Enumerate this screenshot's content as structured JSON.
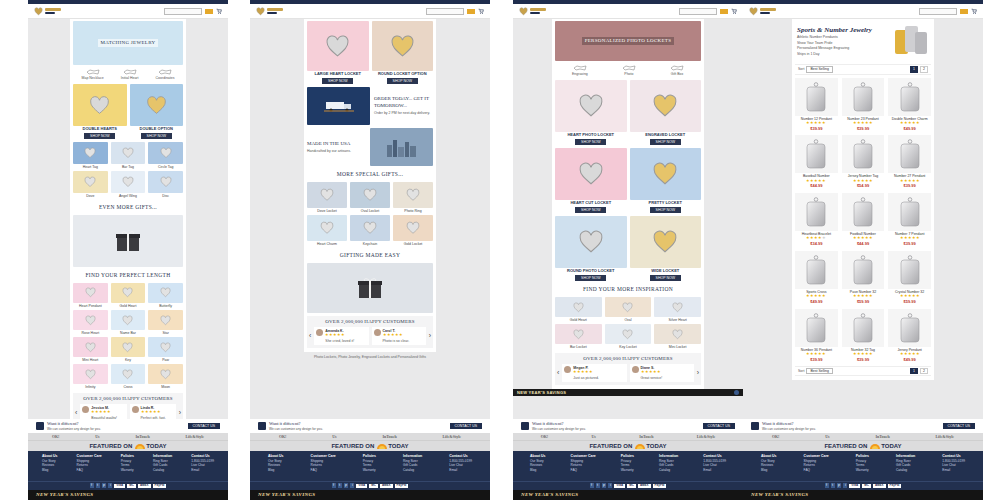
{
  "footer": {
    "custom": {
      "title": "Want it different?",
      "text": "We can customize any design for you.",
      "button": "CONTACT US"
    },
    "press": [
      "OK!",
      "Us",
      "InTouch",
      "Life&Style"
    ],
    "featured": "FEATURED ON",
    "featured_logo": "TODAY",
    "columns": [
      {
        "title": "About Us",
        "links": [
          "Our Story",
          "Reviews",
          "Blog"
        ]
      },
      {
        "title": "Customer Care",
        "links": [
          "Shipping",
          "Returns",
          "FAQ"
        ]
      },
      {
        "title": "Policies",
        "links": [
          "Privacy",
          "Terms",
          "Warranty"
        ]
      },
      {
        "title": "Information",
        "links": [
          "Ring Sizer",
          "Gift Cards",
          "Catalog"
        ]
      },
      {
        "title": "Contact Us",
        "links": [
          "1-800-555-0199",
          "Live Chat",
          "Email"
        ]
      }
    ],
    "social": [
      "f",
      "t",
      "p",
      "i"
    ],
    "payments": [
      "VISA",
      "MC",
      "AMEX",
      "PayPal"
    ],
    "promo": "NEW YEAR'S SAVINGS"
  },
  "panels": [
    {
      "sections": [
        {
          "kind": "hero",
          "title": "MATCHING JEWELRY"
        },
        {
          "kind": "icons",
          "labels": [
            "Map Necklace",
            "Initial Heart",
            "Coordinates"
          ]
        },
        {
          "kind": "pair",
          "items": [
            {
              "caption": "DOUBLE HEARTS",
              "button": "SHOP NOW"
            },
            {
              "caption": "DOUBLE OPTION",
              "button": "SHOP NOW"
            }
          ]
        },
        {
          "kind": "grid",
          "items": [
            {
              "caption": "Heart Tag"
            },
            {
              "caption": "Bar Tag"
            },
            {
              "caption": "Circle Tag"
            },
            {
              "caption": "Dove"
            },
            {
              "caption": "Angel Wing"
            },
            {
              "caption": "Disc"
            }
          ]
        },
        {
          "kind": "heading",
          "title": "EVEN MORE GIFTS..."
        },
        {
          "kind": "hero",
          "title": ""
        },
        {
          "kind": "heading",
          "title": "FIND YOUR PERFECT LENGTH"
        },
        {
          "kind": "grid",
          "items": [
            {
              "caption": "Heart Pendant"
            },
            {
              "caption": "Gold Heart"
            },
            {
              "caption": "Butterfly"
            },
            {
              "caption": "Rose Heart"
            },
            {
              "caption": "Name Bar"
            },
            {
              "caption": "Star"
            },
            {
              "caption": "Mini Heart"
            },
            {
              "caption": "Key"
            },
            {
              "caption": "Paw"
            },
            {
              "caption": "Infinity"
            },
            {
              "caption": "Cross"
            },
            {
              "caption": "Moon"
            }
          ]
        },
        {
          "kind": "reviews",
          "title": "OVER 2,000,000 HAPPY CUSTOMERS",
          "prev": "‹",
          "next": "›",
          "reviews": [
            {
              "name": "Jessica M.",
              "text": "Beautiful quality!",
              "stars": 5
            },
            {
              "name": "Linda R.",
              "text": "Perfect gift, fast.",
              "stars": 5
            }
          ]
        }
      ],
      "note": ""
    },
    {
      "sections": [
        {
          "kind": "pair",
          "items": [
            {
              "caption": "LARGE HEART LOCKET",
              "button": "SHOP NOW"
            },
            {
              "caption": "ROUND LOCKET OPTION",
              "button": "SHOP NOW"
            }
          ]
        },
        {
          "kind": "feature",
          "title": "ORDER TODAY... GET IT TOMORROW...",
          "text": "Order by 2 PM for next-day delivery."
        },
        {
          "kind": "featurerev",
          "title": "MADE IN THE USA",
          "text": "Handcrafted by our artisans."
        },
        {
          "kind": "heading",
          "title": "MORE SPECIAL GIFTS..."
        },
        {
          "kind": "grid",
          "items": [
            {
              "caption": "Dove Locket"
            },
            {
              "caption": "Oval Locket"
            },
            {
              "caption": "Photo Ring"
            },
            {
              "caption": "Heart Charm"
            },
            {
              "caption": "Keychain"
            },
            {
              "caption": "Gold Locket"
            }
          ]
        },
        {
          "kind": "heading",
          "title": "GIFTING MADE EASY"
        },
        {
          "kind": "hero",
          "title": ""
        },
        {
          "kind": "reviews",
          "title": "OVER 2,000,000 HAPPY CUSTOMERS",
          "prev": "‹",
          "next": "›",
          "reviews": [
            {
              "name": "Amanda K.",
              "text": "She cried, loved it!",
              "stars": 5
            },
            {
              "name": "Carol T.",
              "text": "Photo is so clear.",
              "stars": 5
            }
          ]
        }
      ],
      "note": "Photo Lockets, Photo Jewelry, Engraved Lockets and Personalized Gifts"
    },
    {
      "sections": [
        {
          "kind": "hero",
          "title": "PERSONALIZED PHOTO LOCKETS"
        },
        {
          "kind": "icons",
          "labels": [
            "Engraving",
            "Photo",
            "Gift Box"
          ]
        },
        {
          "kind": "pair",
          "items": [
            {
              "caption": "HEART PHOTO LOCKET",
              "button": "SHOP NOW"
            },
            {
              "caption": "ENGRAVED LOCKET",
              "button": "SHOP NOW"
            }
          ]
        },
        {
          "kind": "pair",
          "items": [
            {
              "caption": "HEART CUT LOCKET",
              "button": "SHOP NOW"
            },
            {
              "caption": "PRETTY LOCKET",
              "button": "SHOP NOW"
            }
          ]
        },
        {
          "kind": "pair",
          "items": [
            {
              "caption": "ROUND PHOTO LOCKET",
              "button": "SHOP NOW"
            },
            {
              "caption": "WIDE LOCKET",
              "button": "SHOP NOW"
            }
          ]
        },
        {
          "kind": "heading",
          "title": "FIND YOUR MORE INSPIRATION"
        },
        {
          "kind": "grid",
          "items": [
            {
              "caption": "Gold Heart"
            },
            {
              "caption": "Oval"
            },
            {
              "caption": "Silver Heart"
            },
            {
              "caption": "Bar Locket"
            },
            {
              "caption": "Key Locket"
            },
            {
              "caption": "Mini Locket"
            }
          ]
        },
        {
          "kind": "reviews",
          "title": "OVER 2,000,000 HAPPY CUSTOMERS",
          "prev": "‹",
          "next": "›",
          "reviews": [
            {
              "name": "Megan P.",
              "text": "Just as pictured.",
              "stars": 5
            },
            {
              "name": "Diane S.",
              "text": "Great service!",
              "stars": 5
            }
          ]
        }
      ],
      "note": "",
      "banner": "NEW YEAR'S SAVINGS"
    },
    {
      "sections": [
        {
          "kind": "intro",
          "title": "Sports & Number Jewelry",
          "lines": [
            "Athletic Number Pendants",
            "Show Your Team Pride",
            "Personalized Message Engraving",
            "Ships in 1 Day"
          ]
        },
        {
          "kind": "toolbar",
          "label": "Sort",
          "value": "Best Selling",
          "pages": [
            {
              "label": "1",
              "selected": true
            },
            {
              "label": "2",
              "selected": false
            }
          ]
        },
        {
          "kind": "products",
          "items": [
            {
              "name": "Number 12 Pendant",
              "stars": 5,
              "price": "$39.99"
            },
            {
              "name": "Number 23 Pendant",
              "stars": 5,
              "price": "$39.99"
            },
            {
              "name": "Double Number Charm",
              "stars": 5,
              "price": "$49.99"
            },
            {
              "name": "Baseball Number",
              "stars": 5,
              "price": "$44.99"
            },
            {
              "name": "Jersey Number Tag",
              "stars": 5,
              "price": "$54.99"
            },
            {
              "name": "Number 27 Pendant",
              "stars": 5,
              "price": "$39.99"
            },
            {
              "name": "Heartbeat Bracelet",
              "stars": 4,
              "price": "$34.99"
            },
            {
              "name": "Football Number",
              "stars": 5,
              "price": "$44.99"
            },
            {
              "name": "Number 7 Pendant",
              "stars": 5,
              "price": "$39.99"
            },
            {
              "name": "Sports Cross",
              "stars": 5,
              "price": "$49.99"
            },
            {
              "name": "Pave Number 32",
              "stars": 5,
              "price": "$59.99"
            },
            {
              "name": "Crystal Number 32",
              "stars": 5,
              "price": "$59.99"
            },
            {
              "name": "Number 36 Pendant",
              "stars": 5,
              "price": "$39.99"
            },
            {
              "name": "Number 32 Tag",
              "stars": 5,
              "price": "$39.99"
            },
            {
              "name": "Jersey Pendant",
              "stars": 5,
              "price": "$49.99"
            }
          ]
        },
        {
          "kind": "toolbar",
          "label": "Sort",
          "value": "Best Selling",
          "pages": [
            {
              "label": "1",
              "selected": true
            },
            {
              "label": "2",
              "selected": false
            }
          ]
        }
      ],
      "note": ""
    }
  ]
}
